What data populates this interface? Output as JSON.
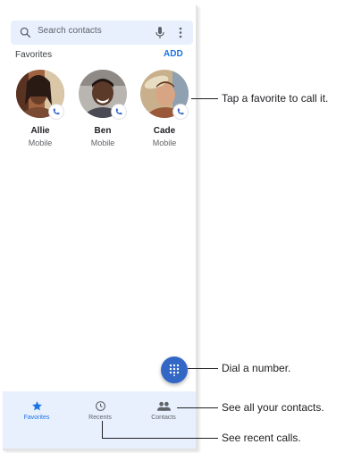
{
  "search": {
    "placeholder": "Search contacts"
  },
  "favorites": {
    "header": "Favorites",
    "add_label": "ADD",
    "items": [
      {
        "name": "Allie",
        "type": "Mobile"
      },
      {
        "name": "Ben",
        "type": "Mobile"
      },
      {
        "name": "Cade",
        "type": "Mobile"
      }
    ]
  },
  "nav": {
    "items": [
      {
        "label": "Favorites",
        "icon": "star-icon",
        "active": true
      },
      {
        "label": "Recents",
        "icon": "clock-icon",
        "active": false
      },
      {
        "label": "Contacts",
        "icon": "people-icon",
        "active": false
      }
    ]
  },
  "callouts": {
    "favorite": "Tap a favorite to call it.",
    "dial": "Dial a number.",
    "contacts": "See all your contacts.",
    "recents": "See recent calls."
  },
  "colors": {
    "accent": "#1a73e8",
    "fab": "#3367c6",
    "surface_tint": "#e8f0fe"
  }
}
